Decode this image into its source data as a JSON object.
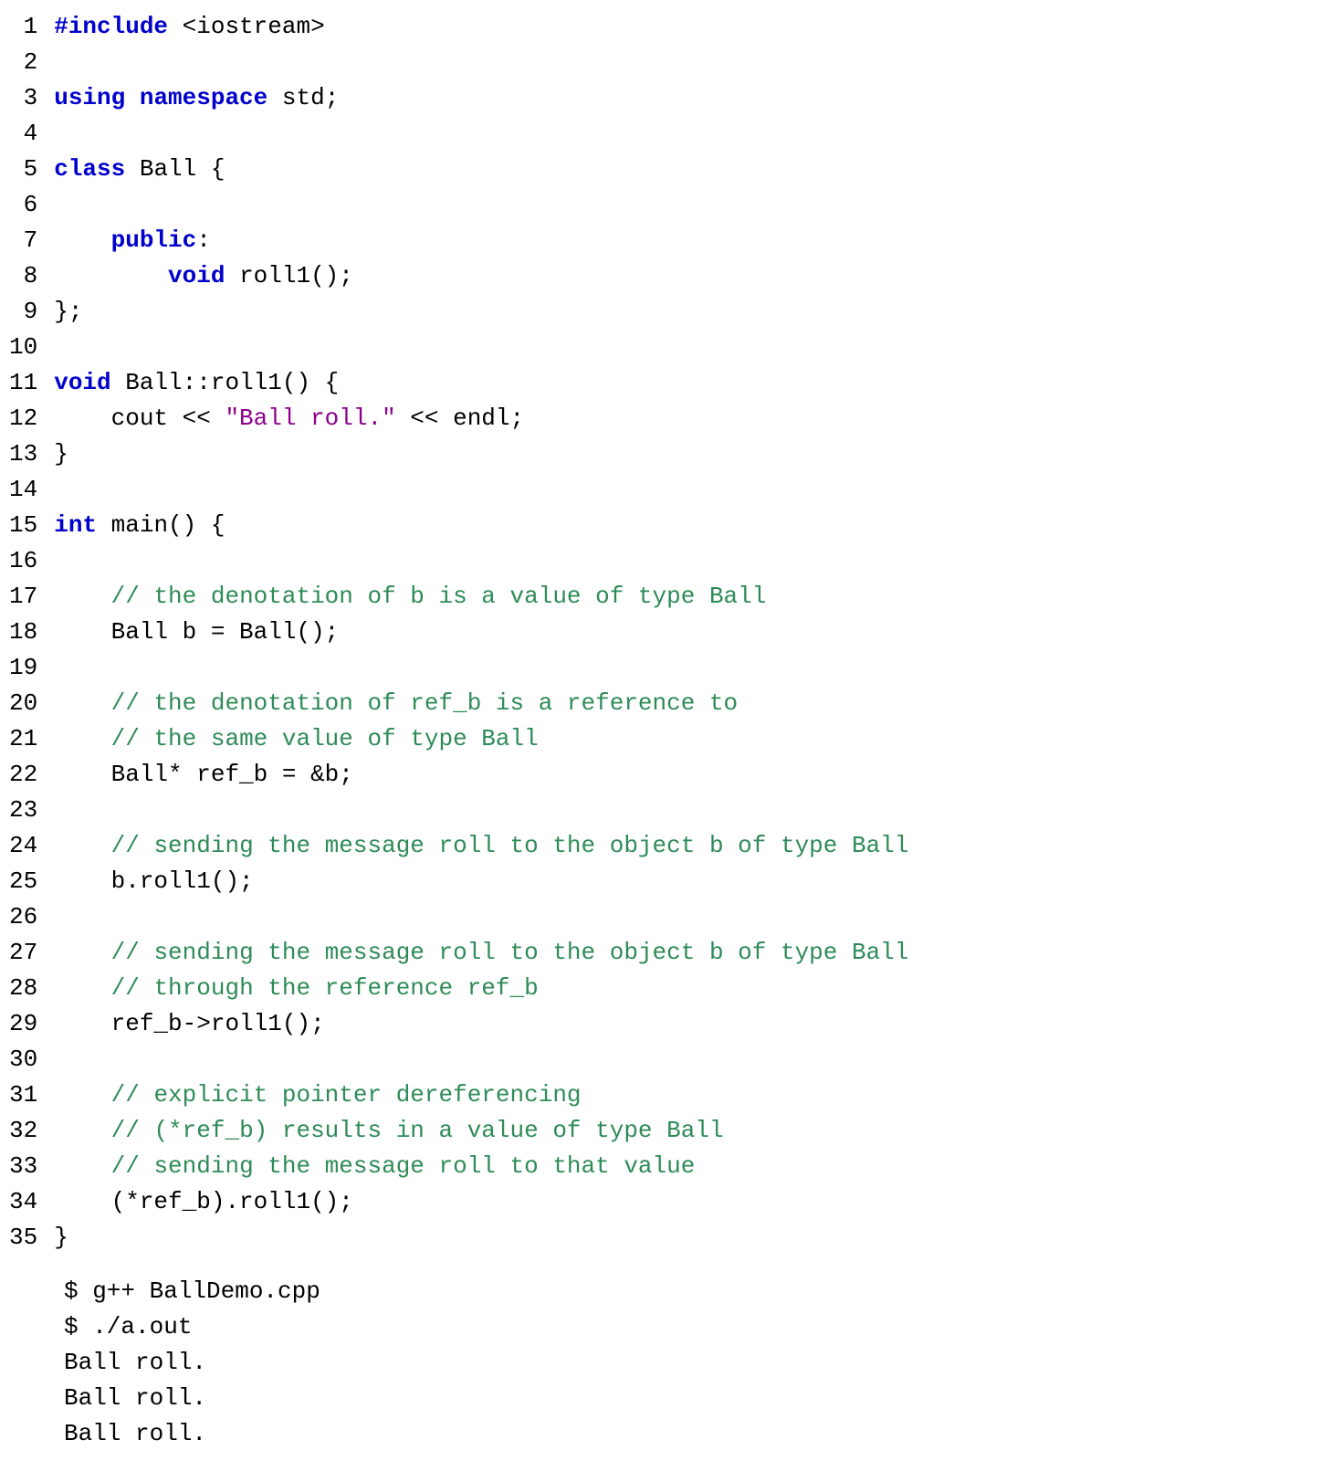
{
  "code": {
    "lines": [
      {
        "n": "1",
        "segments": [
          {
            "cls": "preproc",
            "t": "#include"
          },
          {
            "cls": "plain",
            "t": " <iostream>"
          }
        ]
      },
      {
        "n": "2",
        "segments": []
      },
      {
        "n": "3",
        "segments": [
          {
            "cls": "kw",
            "t": "using"
          },
          {
            "cls": "plain",
            "t": " "
          },
          {
            "cls": "kw",
            "t": "namespace"
          },
          {
            "cls": "plain",
            "t": " std;"
          }
        ]
      },
      {
        "n": "4",
        "segments": []
      },
      {
        "n": "5",
        "segments": [
          {
            "cls": "kw",
            "t": "class"
          },
          {
            "cls": "plain",
            "t": " Ball {"
          }
        ]
      },
      {
        "n": "6",
        "segments": []
      },
      {
        "n": "7",
        "segments": [
          {
            "cls": "plain",
            "t": "    "
          },
          {
            "cls": "kw",
            "t": "public"
          },
          {
            "cls": "plain",
            "t": ":"
          }
        ]
      },
      {
        "n": "8",
        "segments": [
          {
            "cls": "plain",
            "t": "        "
          },
          {
            "cls": "kw",
            "t": "void"
          },
          {
            "cls": "plain",
            "t": " roll1();"
          }
        ]
      },
      {
        "n": "9",
        "segments": [
          {
            "cls": "plain",
            "t": "};"
          }
        ]
      },
      {
        "n": "10",
        "segments": []
      },
      {
        "n": "11",
        "segments": [
          {
            "cls": "kw",
            "t": "void"
          },
          {
            "cls": "plain",
            "t": " Ball::roll1() {"
          }
        ]
      },
      {
        "n": "12",
        "segments": [
          {
            "cls": "plain",
            "t": "    cout << "
          },
          {
            "cls": "str",
            "t": "\"Ball roll.\""
          },
          {
            "cls": "plain",
            "t": " << endl;"
          }
        ]
      },
      {
        "n": "13",
        "segments": [
          {
            "cls": "plain",
            "t": "}"
          }
        ]
      },
      {
        "n": "14",
        "segments": []
      },
      {
        "n": "15",
        "segments": [
          {
            "cls": "kw",
            "t": "int"
          },
          {
            "cls": "plain",
            "t": " main() {"
          }
        ]
      },
      {
        "n": "16",
        "segments": []
      },
      {
        "n": "17",
        "segments": [
          {
            "cls": "plain",
            "t": "    "
          },
          {
            "cls": "cmt",
            "t": "// the denotation of b is a value of type Ball"
          }
        ]
      },
      {
        "n": "18",
        "segments": [
          {
            "cls": "plain",
            "t": "    Ball b = Ball();"
          }
        ]
      },
      {
        "n": "19",
        "segments": []
      },
      {
        "n": "20",
        "segments": [
          {
            "cls": "plain",
            "t": "    "
          },
          {
            "cls": "cmt",
            "t": "// the denotation of ref_b is a reference to"
          }
        ]
      },
      {
        "n": "21",
        "segments": [
          {
            "cls": "plain",
            "t": "    "
          },
          {
            "cls": "cmt",
            "t": "// the same value of type Ball"
          }
        ]
      },
      {
        "n": "22",
        "segments": [
          {
            "cls": "plain",
            "t": "    Ball* ref_b = &b;"
          }
        ]
      },
      {
        "n": "23",
        "segments": []
      },
      {
        "n": "24",
        "segments": [
          {
            "cls": "plain",
            "t": "    "
          },
          {
            "cls": "cmt",
            "t": "// sending the message roll to the object b of type Ball"
          }
        ]
      },
      {
        "n": "25",
        "segments": [
          {
            "cls": "plain",
            "t": "    b.roll1();"
          }
        ]
      },
      {
        "n": "26",
        "segments": []
      },
      {
        "n": "27",
        "segments": [
          {
            "cls": "plain",
            "t": "    "
          },
          {
            "cls": "cmt",
            "t": "// sending the message roll to the object b of type Ball"
          }
        ]
      },
      {
        "n": "28",
        "segments": [
          {
            "cls": "plain",
            "t": "    "
          },
          {
            "cls": "cmt",
            "t": "// through the reference ref_b"
          }
        ]
      },
      {
        "n": "29",
        "segments": [
          {
            "cls": "plain",
            "t": "    ref_b->roll1();"
          }
        ]
      },
      {
        "n": "30",
        "segments": []
      },
      {
        "n": "31",
        "segments": [
          {
            "cls": "plain",
            "t": "    "
          },
          {
            "cls": "cmt",
            "t": "// explicit pointer dereferencing"
          }
        ]
      },
      {
        "n": "32",
        "segments": [
          {
            "cls": "plain",
            "t": "    "
          },
          {
            "cls": "cmt",
            "t": "// (*ref_b) results in a value of type Ball"
          }
        ]
      },
      {
        "n": "33",
        "segments": [
          {
            "cls": "plain",
            "t": "    "
          },
          {
            "cls": "cmt",
            "t": "// sending the message roll to that value"
          }
        ]
      },
      {
        "n": "34",
        "segments": [
          {
            "cls": "plain",
            "t": "    (*ref_b).roll1();"
          }
        ]
      },
      {
        "n": "35",
        "segments": [
          {
            "cls": "plain",
            "t": "}"
          }
        ]
      }
    ]
  },
  "terminal": {
    "lines": [
      "$ g++ BallDemo.cpp",
      "$ ./a.out",
      "Ball roll.",
      "Ball roll.",
      "Ball roll."
    ]
  }
}
